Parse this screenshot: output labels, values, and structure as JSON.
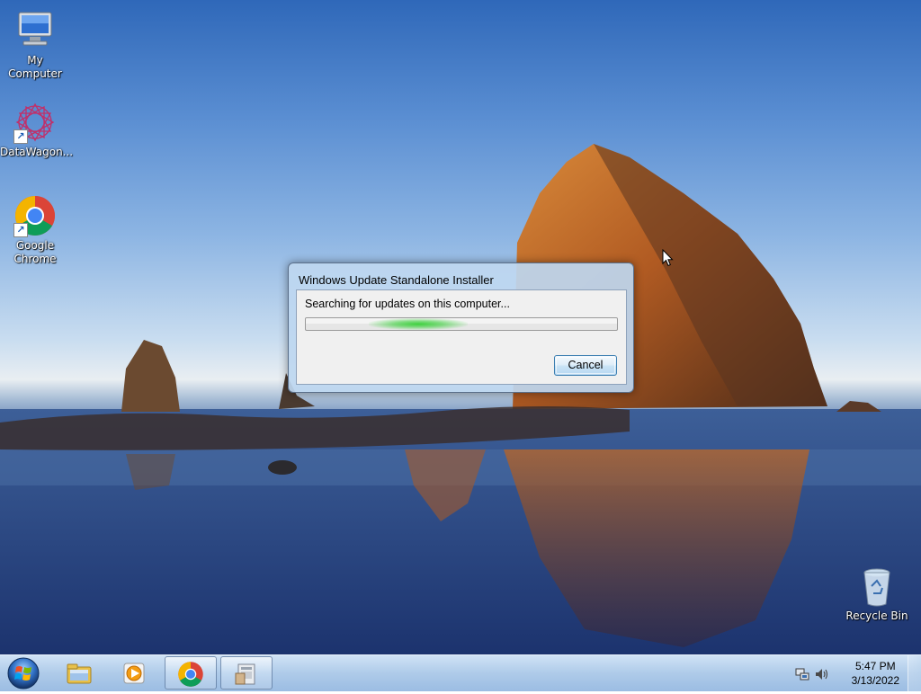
{
  "desktop": {
    "icons": [
      {
        "label": "My Computer",
        "icon": "computer-icon"
      },
      {
        "label": "DataWagon...",
        "icon": "datawagon-icon",
        "shortcut": true
      },
      {
        "label": "Google Chrome",
        "icon": "chrome-icon",
        "shortcut": true
      },
      {
        "label": "Recycle Bin",
        "icon": "recycle-bin-icon"
      }
    ]
  },
  "dialog": {
    "title": "Windows Update Standalone Installer",
    "message": "Searching for updates on this computer...",
    "cancel_label": "Cancel",
    "progress_state": "indeterminate"
  },
  "taskbar": {
    "start": {
      "icon": "windows-start-icon"
    },
    "buttons": [
      {
        "icon": "file-explorer-icon",
        "active": false
      },
      {
        "icon": "media-player-icon",
        "active": false
      },
      {
        "icon": "chrome-icon",
        "active": true
      },
      {
        "icon": "update-installer-icon",
        "active": true
      }
    ],
    "tray": {
      "icons": [
        "network-icon",
        "volume-icon"
      ],
      "time": "5:47 PM",
      "date": "3/13/2022"
    }
  },
  "colors": {
    "taskbar": "#b4cce8",
    "dialog_frame": "#bed7f0",
    "progress_green": "#3ed13e"
  }
}
